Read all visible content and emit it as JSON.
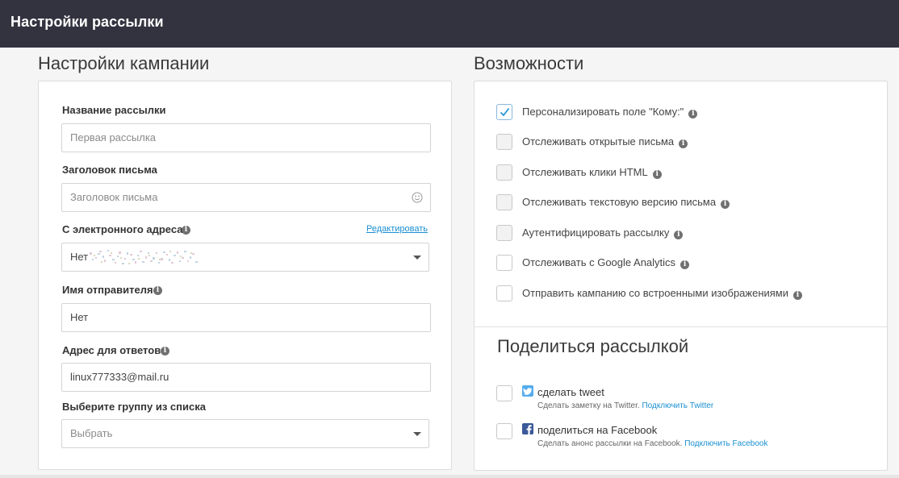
{
  "header": {
    "title": "Настройки рассылки"
  },
  "campaign": {
    "title": "Настройки кампании",
    "name_label": "Название рассылки",
    "name_placeholder": "Первая рассылка",
    "subject_label": "Заголовок письма",
    "subject_placeholder": "Заголовок письма",
    "from_label": "С электронного адреса",
    "edit_link": "Редактировать",
    "from_value": "Нет",
    "sender_label": "Имя отправителя",
    "sender_value": "Нет",
    "reply_label": "Адрес для ответов",
    "reply_value": "linux777333@mail.ru",
    "group_label": "Выберите группу из списка",
    "group_value": "Выбрать"
  },
  "features": {
    "title": "Возможности",
    "options": [
      {
        "label": "Персонализировать поле \"Кому:\"",
        "checked": true
      },
      {
        "label": "Отслеживать открытые письма",
        "checked": false
      },
      {
        "label": "Отслеживать клики HTML",
        "checked": false
      },
      {
        "label": "Отслеживать текстовую версию письма",
        "checked": false
      },
      {
        "label": "Аутентифицировать рассылку",
        "checked": false
      },
      {
        "label": "Отслеживать с Google Analytics",
        "checked": false
      },
      {
        "label": "Отправить кампанию со встроенными изображениями",
        "checked": false
      }
    ]
  },
  "share": {
    "title": "Поделиться рассылкой",
    "twitter": {
      "label": "сделать tweet",
      "desc": "Сделать заметку на Twitter.",
      "link": "Подключить Twitter",
      "color": "#55acee"
    },
    "facebook": {
      "label": "поделиться на Facebook",
      "desc": "Сделать анонс рассылки на Facebook.",
      "link": "Подключить Facebook",
      "color": "#3b5998"
    }
  },
  "colors": {
    "header_bg": "#33323f",
    "link": "#1a8fd1",
    "check": "#1a8fd1"
  }
}
